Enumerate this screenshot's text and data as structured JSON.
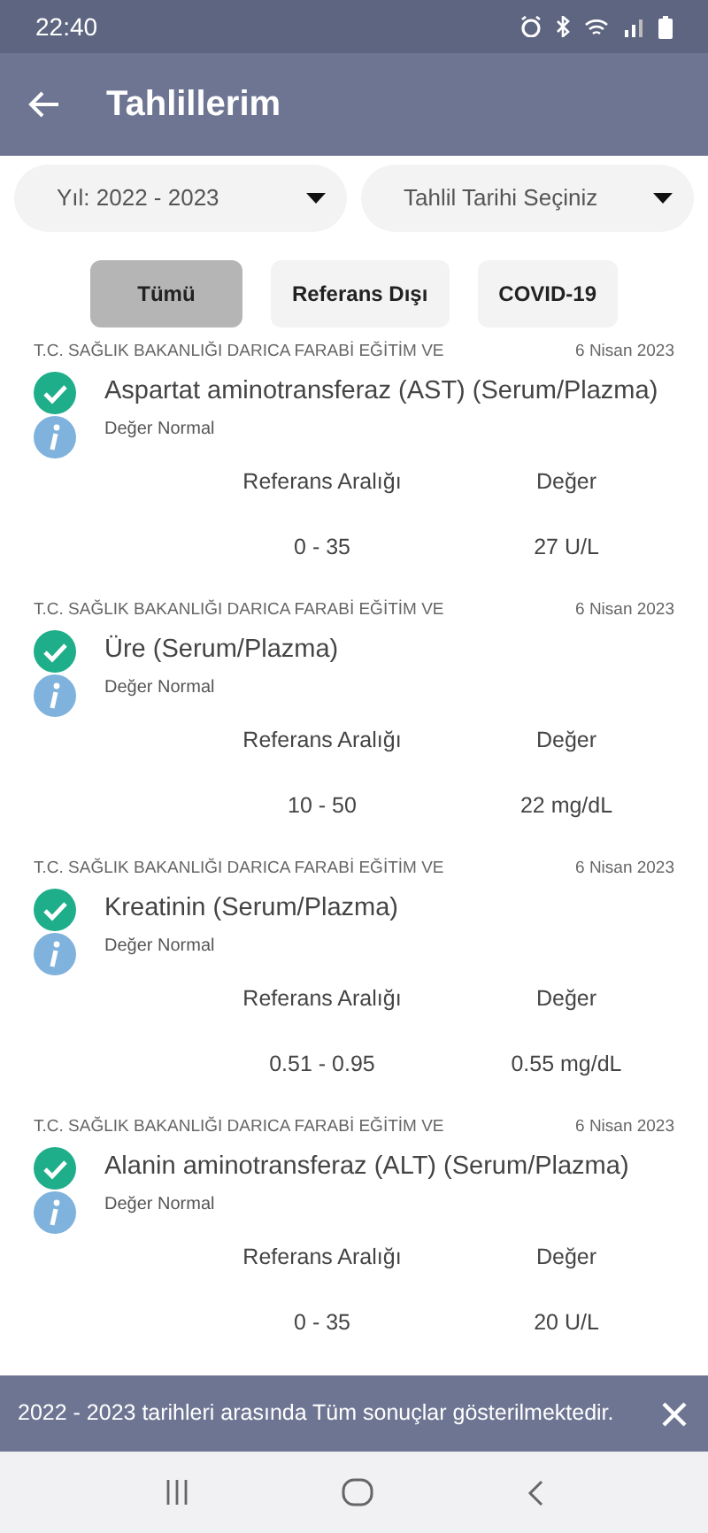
{
  "status_bar": {
    "time": "22:40"
  },
  "app_bar": {
    "title": "Tahlillerim"
  },
  "filters": [
    {
      "label": "Yıl: 2022 - 2023"
    },
    {
      "label": "Tahlil Tarihi Seçiniz"
    }
  ],
  "chips": [
    {
      "label": "Tümü",
      "selected": true
    },
    {
      "label": "Referans Dışı",
      "selected": false
    },
    {
      "label": "COVID-19",
      "selected": false
    }
  ],
  "results": [
    {
      "institution": "T.C. SAĞLIK BAKANLIĞI DARICA FARABİ EĞİTİM VE",
      "date": "6 Nisan 2023",
      "test": "Aspartat aminotransferaz (AST) (Serum/Plazma)",
      "out_of_range": false,
      "note": "Değer Normal",
      "range_label": "Referans Aralığı",
      "value_label": "Değer",
      "range": "0 - 35",
      "value": "27 U/L"
    },
    {
      "institution": "T.C. SAĞLIK BAKANLIĞI DARICA FARABİ EĞİTİM VE",
      "date": "6 Nisan 2023",
      "test": "Üre (Serum/Plazma)",
      "out_of_range": false,
      "note": "Değer Normal",
      "range_label": "Referans Aralığı",
      "value_label": "Değer",
      "range": "10 - 50",
      "value": "22 mg/dL"
    },
    {
      "institution": "T.C. SAĞLIK BAKANLIĞI DARICA FARABİ EĞİTİM VE",
      "date": "6 Nisan 2023",
      "test": "Kreatinin (Serum/Plazma)",
      "out_of_range": false,
      "note": "Değer Normal",
      "range_label": "Referans Aralığı",
      "value_label": "Değer",
      "range": "0.51 - 0.95",
      "value": "0.55 mg/dL"
    },
    {
      "institution": "T.C. SAĞLIK BAKANLIĞI DARICA FARABİ EĞİTİM VE",
      "date": "6 Nisan 2023",
      "test": "Alanin aminotransferaz (ALT) (Serum/Plazma)",
      "out_of_range": false,
      "note": "Değer Normal",
      "range_label": "Referans Aralığı",
      "value_label": "Değer",
      "range": "0 - 35",
      "value": "20 U/L"
    }
  ],
  "snackbar": {
    "message": "2022 - 2023 tarihleri arasında Tüm sonuçlar gösterilmektedir."
  }
}
